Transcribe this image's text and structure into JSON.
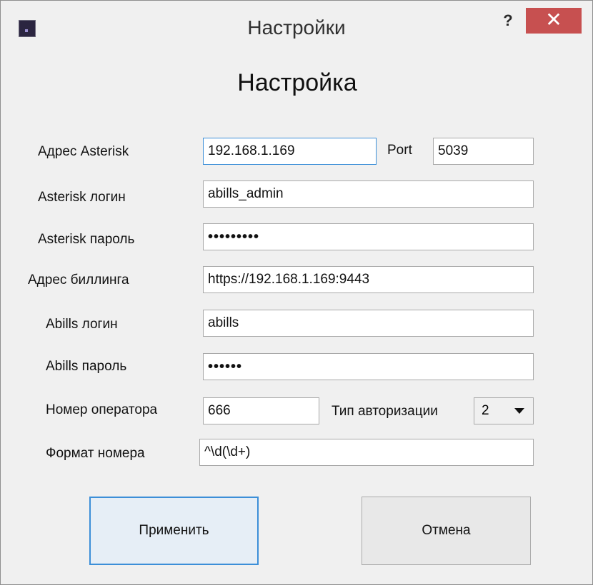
{
  "window": {
    "title": "Настройки",
    "help_label": "?",
    "close_label": "✕",
    "icon": "app-icon"
  },
  "form": {
    "heading": "Настройка",
    "asterisk_address": {
      "label": "Адрес Asterisk",
      "value": "192.168.1.169"
    },
    "port": {
      "label": "Port",
      "value": "5039"
    },
    "asterisk_login": {
      "label": "Asterisk логин",
      "value": "abills_admin"
    },
    "asterisk_password": {
      "label": "Asterisk пароль",
      "value": "•••••••••"
    },
    "billing_address": {
      "label": "Адрес биллинга",
      "value": "https://192.168.1.169:9443"
    },
    "abills_login": {
      "label": "Abills логин",
      "value": "abills"
    },
    "abills_password": {
      "label": "Abills пароль",
      "value": "••••••"
    },
    "operator_number": {
      "label": "Номер оператора",
      "value": "666"
    },
    "auth_type": {
      "label": "Тип авторизации",
      "value": "2"
    },
    "number_format": {
      "label": "Формат номера",
      "value": "^\\d(\\d+)"
    }
  },
  "buttons": {
    "apply": "Применить",
    "cancel": "Отмена"
  },
  "colors": {
    "focus_border": "#3c8fd8",
    "close_button": "#c75050"
  }
}
